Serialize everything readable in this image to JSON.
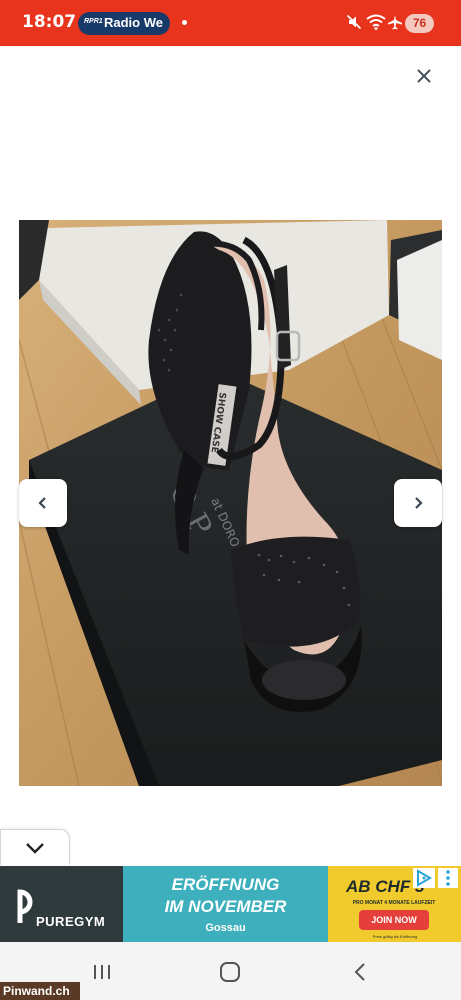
{
  "status_bar": {
    "time": "18:07",
    "radio_logo": "RPR1",
    "radio_label": "Radio We",
    "battery": "76",
    "icons": [
      "notification-dot",
      "mute-icon",
      "wifi-icon",
      "airplane-icon",
      "battery-icon"
    ],
    "background_color": "#e8341c"
  },
  "viewer": {
    "close_icon": "close-icon",
    "prev_icon": "chevron-left-icon",
    "next_icon": "chevron-right-icon",
    "photo_subject": "black ankle-strap heeled sandal on shoe box",
    "box_label": "at DORO",
    "insole_label": "SHOW CASE"
  },
  "collapse_tab": {
    "icon": "chevron-down-icon"
  },
  "ad": {
    "brand": "PUREGYM",
    "headline_line1": "ERÖFFNUNG",
    "headline_line2": "IM NOVEMBER",
    "location": "Gossau",
    "price": "AB CHF 3",
    "fine_print": "PRO MONAT 4 MONATE LAUFZEIT",
    "cta": "JOIN NOW",
    "legal": "Preis gültig bis Eröffnung",
    "colors": {
      "left": "#2e3a3b",
      "mid": "#3eb0bd",
      "right": "#f1ca2d",
      "cta": "#e43f3a"
    }
  },
  "system_nav": {
    "icons": [
      "recents-icon",
      "home-icon",
      "back-icon"
    ]
  },
  "watermark": "Pinwand.ch"
}
